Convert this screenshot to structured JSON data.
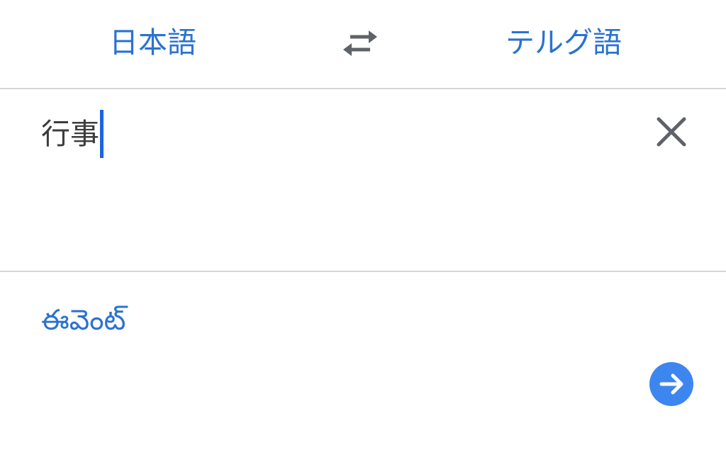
{
  "header": {
    "source_language": "日本語",
    "target_language": "テルグ語",
    "swap_icon": "swap-arrows-icon"
  },
  "input": {
    "text": "行事",
    "clear_icon": "close-icon"
  },
  "output": {
    "translation": "ఈవెంట్",
    "go_icon": "arrow-right-icon"
  },
  "colors": {
    "accent": "#2b72d0",
    "caret": "#1a66e0",
    "go_button": "#3d86f0",
    "icon_gray": "#5f6368",
    "divider": "#d6d6d6"
  }
}
